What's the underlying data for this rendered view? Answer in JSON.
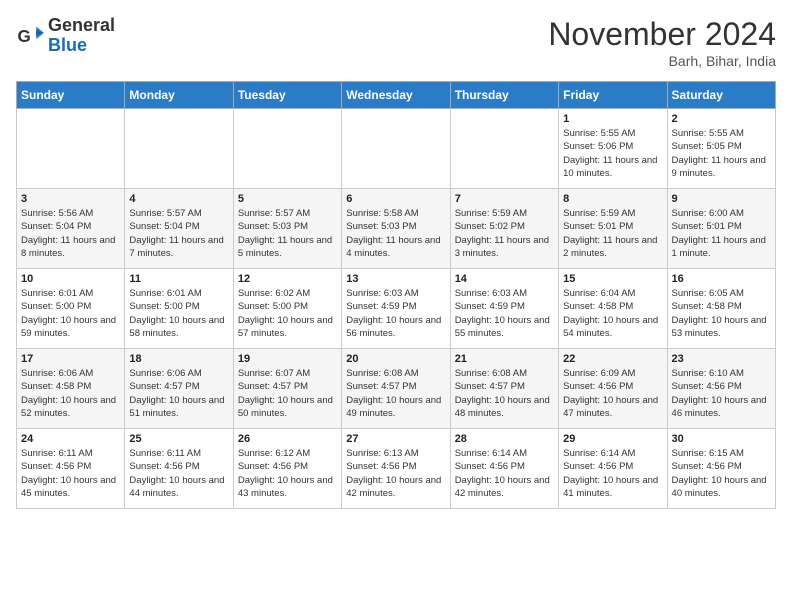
{
  "header": {
    "logo_general": "General",
    "logo_blue": "Blue",
    "month": "November 2024",
    "location": "Barh, Bihar, India"
  },
  "weekdays": [
    "Sunday",
    "Monday",
    "Tuesday",
    "Wednesday",
    "Thursday",
    "Friday",
    "Saturday"
  ],
  "weeks": [
    [
      {
        "day": "",
        "info": ""
      },
      {
        "day": "",
        "info": ""
      },
      {
        "day": "",
        "info": ""
      },
      {
        "day": "",
        "info": ""
      },
      {
        "day": "",
        "info": ""
      },
      {
        "day": "1",
        "info": "Sunrise: 5:55 AM\nSunset: 5:06 PM\nDaylight: 11 hours and 10 minutes."
      },
      {
        "day": "2",
        "info": "Sunrise: 5:55 AM\nSunset: 5:05 PM\nDaylight: 11 hours and 9 minutes."
      }
    ],
    [
      {
        "day": "3",
        "info": "Sunrise: 5:56 AM\nSunset: 5:04 PM\nDaylight: 11 hours and 8 minutes."
      },
      {
        "day": "4",
        "info": "Sunrise: 5:57 AM\nSunset: 5:04 PM\nDaylight: 11 hours and 7 minutes."
      },
      {
        "day": "5",
        "info": "Sunrise: 5:57 AM\nSunset: 5:03 PM\nDaylight: 11 hours and 5 minutes."
      },
      {
        "day": "6",
        "info": "Sunrise: 5:58 AM\nSunset: 5:03 PM\nDaylight: 11 hours and 4 minutes."
      },
      {
        "day": "7",
        "info": "Sunrise: 5:59 AM\nSunset: 5:02 PM\nDaylight: 11 hours and 3 minutes."
      },
      {
        "day": "8",
        "info": "Sunrise: 5:59 AM\nSunset: 5:01 PM\nDaylight: 11 hours and 2 minutes."
      },
      {
        "day": "9",
        "info": "Sunrise: 6:00 AM\nSunset: 5:01 PM\nDaylight: 11 hours and 1 minute."
      }
    ],
    [
      {
        "day": "10",
        "info": "Sunrise: 6:01 AM\nSunset: 5:00 PM\nDaylight: 10 hours and 59 minutes."
      },
      {
        "day": "11",
        "info": "Sunrise: 6:01 AM\nSunset: 5:00 PM\nDaylight: 10 hours and 58 minutes."
      },
      {
        "day": "12",
        "info": "Sunrise: 6:02 AM\nSunset: 5:00 PM\nDaylight: 10 hours and 57 minutes."
      },
      {
        "day": "13",
        "info": "Sunrise: 6:03 AM\nSunset: 4:59 PM\nDaylight: 10 hours and 56 minutes."
      },
      {
        "day": "14",
        "info": "Sunrise: 6:03 AM\nSunset: 4:59 PM\nDaylight: 10 hours and 55 minutes."
      },
      {
        "day": "15",
        "info": "Sunrise: 6:04 AM\nSunset: 4:58 PM\nDaylight: 10 hours and 54 minutes."
      },
      {
        "day": "16",
        "info": "Sunrise: 6:05 AM\nSunset: 4:58 PM\nDaylight: 10 hours and 53 minutes."
      }
    ],
    [
      {
        "day": "17",
        "info": "Sunrise: 6:06 AM\nSunset: 4:58 PM\nDaylight: 10 hours and 52 minutes."
      },
      {
        "day": "18",
        "info": "Sunrise: 6:06 AM\nSunset: 4:57 PM\nDaylight: 10 hours and 51 minutes."
      },
      {
        "day": "19",
        "info": "Sunrise: 6:07 AM\nSunset: 4:57 PM\nDaylight: 10 hours and 50 minutes."
      },
      {
        "day": "20",
        "info": "Sunrise: 6:08 AM\nSunset: 4:57 PM\nDaylight: 10 hours and 49 minutes."
      },
      {
        "day": "21",
        "info": "Sunrise: 6:08 AM\nSunset: 4:57 PM\nDaylight: 10 hours and 48 minutes."
      },
      {
        "day": "22",
        "info": "Sunrise: 6:09 AM\nSunset: 4:56 PM\nDaylight: 10 hours and 47 minutes."
      },
      {
        "day": "23",
        "info": "Sunrise: 6:10 AM\nSunset: 4:56 PM\nDaylight: 10 hours and 46 minutes."
      }
    ],
    [
      {
        "day": "24",
        "info": "Sunrise: 6:11 AM\nSunset: 4:56 PM\nDaylight: 10 hours and 45 minutes."
      },
      {
        "day": "25",
        "info": "Sunrise: 6:11 AM\nSunset: 4:56 PM\nDaylight: 10 hours and 44 minutes."
      },
      {
        "day": "26",
        "info": "Sunrise: 6:12 AM\nSunset: 4:56 PM\nDaylight: 10 hours and 43 minutes."
      },
      {
        "day": "27",
        "info": "Sunrise: 6:13 AM\nSunset: 4:56 PM\nDaylight: 10 hours and 42 minutes."
      },
      {
        "day": "28",
        "info": "Sunrise: 6:14 AM\nSunset: 4:56 PM\nDaylight: 10 hours and 42 minutes."
      },
      {
        "day": "29",
        "info": "Sunrise: 6:14 AM\nSunset: 4:56 PM\nDaylight: 10 hours and 41 minutes."
      },
      {
        "day": "30",
        "info": "Sunrise: 6:15 AM\nSunset: 4:56 PM\nDaylight: 10 hours and 40 minutes."
      }
    ]
  ]
}
